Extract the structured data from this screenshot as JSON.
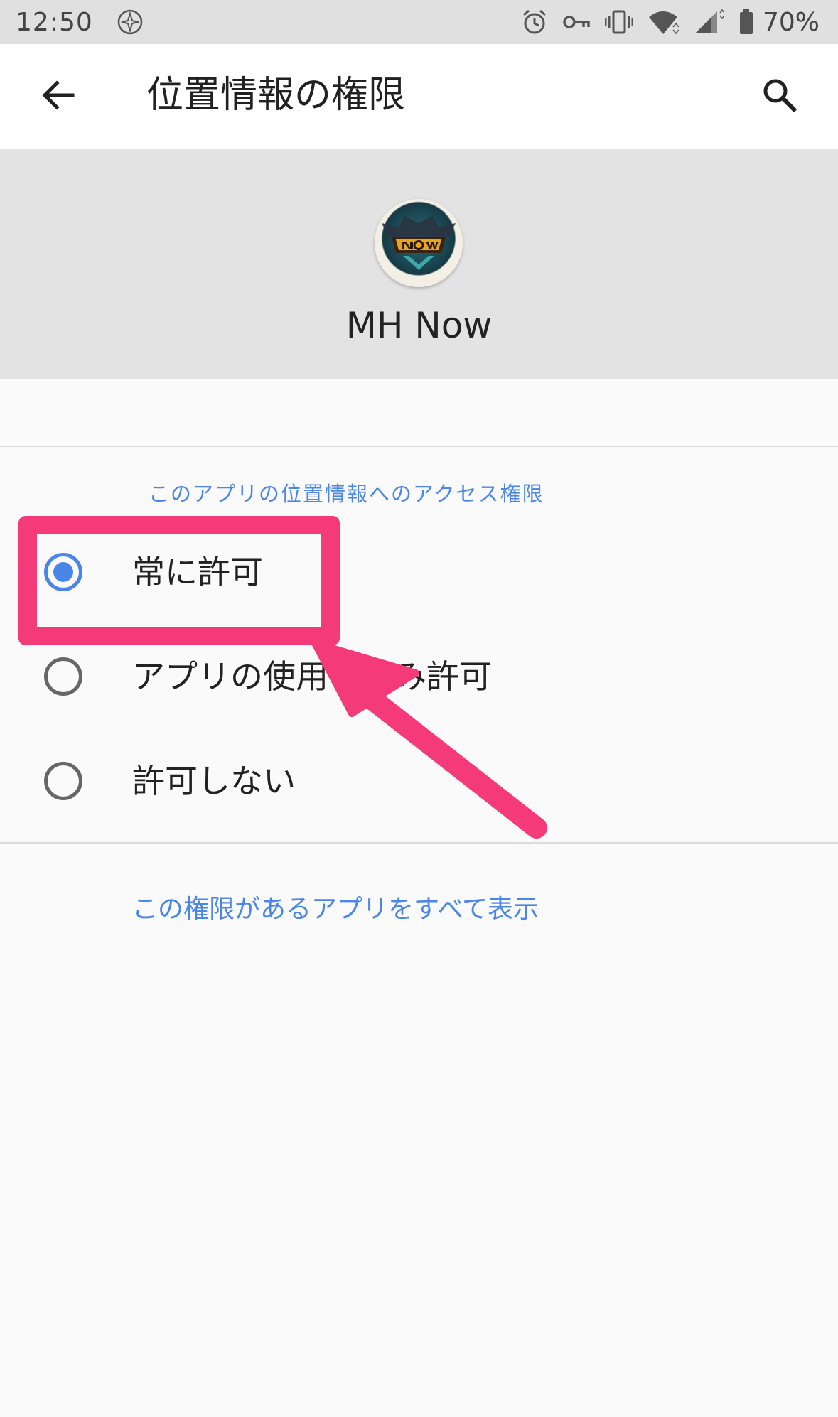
{
  "status_bar": {
    "time": "12:50",
    "battery": "70%",
    "icons": [
      "app-notification-icon",
      "alarm-icon",
      "vpn-key-icon",
      "vibrate-icon",
      "wifi-icon",
      "signal-icon",
      "battery-icon"
    ]
  },
  "app_bar": {
    "title": "位置情報の権限",
    "back_icon": "arrow-back-icon",
    "search_icon": "search-icon"
  },
  "app_header": {
    "name": "MH Now"
  },
  "permission": {
    "section_label": "このアプリの位置情報へのアクセス権限",
    "options": [
      {
        "label": "常に許可",
        "selected": true
      },
      {
        "label": "アプリの使用中のみ許可",
        "selected": false
      },
      {
        "label": "許可しない",
        "selected": false
      }
    ]
  },
  "link": {
    "label": "この権限があるアプリをすべて表示"
  },
  "colors": {
    "accent": "#4a86e8",
    "annotation": "#f53a7a",
    "status_bar": "#e0e0e0",
    "header": "#e3e3e3"
  }
}
